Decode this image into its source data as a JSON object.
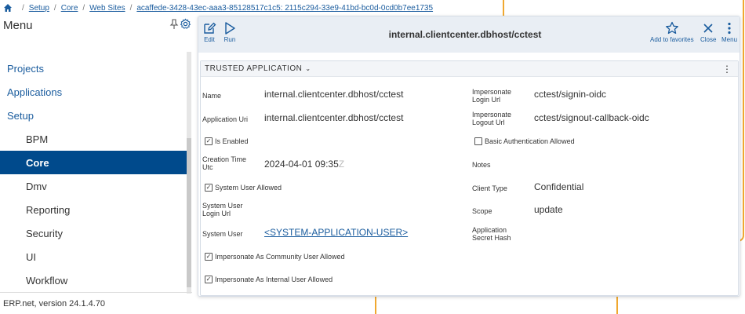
{
  "breadcrumb": {
    "items": [
      "Setup",
      "Core",
      "Web Sites"
    ],
    "current": "acaffede-3428-43ec-aaa3-85128517c1c5: 2115c294-33e9-41bd-bc0d-0cd0b7ee1735"
  },
  "sidebar": {
    "title": "Menu",
    "items": [
      {
        "label": "Projects"
      },
      {
        "label": "Applications"
      },
      {
        "label": "Setup"
      },
      {
        "label": "BPM"
      },
      {
        "label": "Core"
      },
      {
        "label": "Dmv"
      },
      {
        "label": "Reporting"
      },
      {
        "label": "Security"
      },
      {
        "label": "UI"
      },
      {
        "label": "Workflow"
      }
    ],
    "active": "Core",
    "version": "ERP.net, version 24.1.4.70"
  },
  "toolbar": {
    "edit_label": "Edit",
    "run_label": "Run",
    "title": "internal.clientcenter.dbhost/cctest",
    "favorites_label": "Add to favorites",
    "close_label": "Close",
    "menu_label": "Menu"
  },
  "section": {
    "title": "TRUSTED APPLICATION",
    "fields": {
      "name_label": "Name",
      "name_value": "internal.clientcenter.dbhost/cctest",
      "app_uri_label": "Application Uri",
      "app_uri_value": "internal.clientcenter.dbhost/cctest",
      "is_enabled_label": "Is Enabled",
      "is_enabled": true,
      "creation_time_label": "Creation Time Utc",
      "creation_time_value": "2024-04-01 09:35",
      "creation_time_faded": "Z",
      "system_user_allowed_label": "System User Allowed",
      "system_user_allowed": true,
      "system_user_login_url_label": "System User Login Url",
      "system_user_label": "System User",
      "system_user_value": "<SYSTEM-APPLICATION-USER>",
      "imp_community_label": "Impersonate As Community User Allowed",
      "imp_community": true,
      "imp_internal_label": "Impersonate As Internal User Allowed",
      "imp_internal": true,
      "imp_login_url_label": "Impersonate Login Url",
      "imp_login_url_value": "cctest/signin-oidc",
      "imp_logout_url_label": "Impersonate Logout Url",
      "imp_logout_url_value": "cctest/signout-callback-oidc",
      "basic_auth_label": "Basic Authentication Allowed",
      "basic_auth": false,
      "notes_label": "Notes",
      "client_type_label": "Client Type",
      "client_type_value": "Confidential",
      "scope_label": "Scope",
      "scope_value": "update",
      "secret_hash_label": "Application Secret Hash"
    }
  },
  "colors": {
    "accent": "#1a5c9e",
    "active_nav": "#004a8c",
    "canvas_frame": "#f0a830"
  }
}
